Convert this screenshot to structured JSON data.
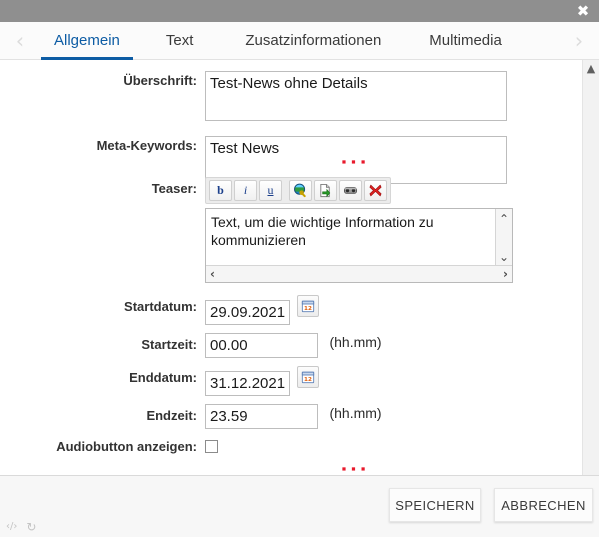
{
  "window": {
    "close_label": "✖"
  },
  "tabbar": {
    "prev_label": "‹",
    "next_label": "›",
    "tabs": [
      {
        "label": "Allgemein",
        "active": true
      },
      {
        "label": "Text",
        "active": false
      },
      {
        "label": "Zusatzinformationen",
        "active": false
      },
      {
        "label": "Multimedia",
        "active": false
      }
    ]
  },
  "form": {
    "ueberschrift": {
      "label": "Überschrift:",
      "value": "Test-News ohne Details"
    },
    "meta_keywords": {
      "label": "Meta-Keywords:",
      "value": "Test News"
    },
    "teaser": {
      "label": "Teaser:",
      "value": "Text, um die wichtige Information zu kommunizieren",
      "toolbar": [
        {
          "name": "bold",
          "glyph": "b"
        },
        {
          "name": "italic",
          "glyph": "i"
        },
        {
          "name": "underline",
          "glyph": "u"
        },
        {
          "name": "insert-link",
          "glyph": ""
        },
        {
          "name": "insert-page-link",
          "glyph": ""
        },
        {
          "name": "insert-anchor",
          "glyph": ""
        },
        {
          "name": "remove-link",
          "glyph": "✖"
        }
      ]
    },
    "startdatum": {
      "label": "Startdatum:",
      "value": "29.09.2021",
      "calendar_day": "12"
    },
    "startzeit": {
      "label": "Startzeit:",
      "value": "00.00",
      "hint": "(hh.mm)"
    },
    "enddatum": {
      "label": "Enddatum:",
      "value": "31.12.2021",
      "calendar_day": "12"
    },
    "endzeit": {
      "label": "Endzeit:",
      "value": "23.59",
      "hint": "(hh.mm)"
    },
    "audiobutton": {
      "label": "Audiobutton anzeigen:",
      "checked": false
    },
    "loading_dots": "▪▪▪"
  },
  "scrollbar": {
    "up_arrow": "▲",
    "editor_up": "⌃",
    "editor_down": "⌄",
    "editor_left": "‹",
    "editor_right": "›"
  },
  "footer": {
    "save_label": "SPEICHERN",
    "cancel_label": "ABBRECHEN",
    "code_icon": "‹/›",
    "refresh_icon": "↻"
  },
  "colors": {
    "accent": "#0d5ca4",
    "titlebar": "#8f8f8f",
    "dots": "#e8192c"
  }
}
